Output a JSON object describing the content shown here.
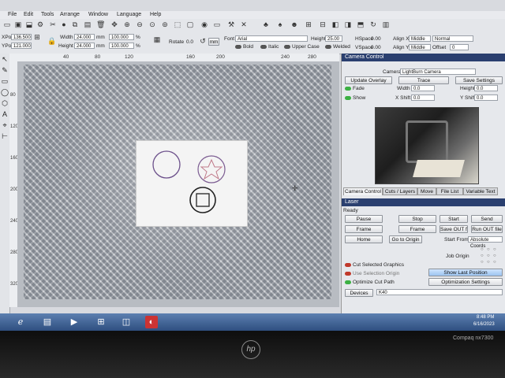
{
  "menu": [
    "File",
    "Edit",
    "Tools",
    "Arrange",
    "Window",
    "Language",
    "Help"
  ],
  "toolbar": {
    "x_label": "XPos",
    "x_value": "136.500",
    "y_label": "YPos",
    "y_value": "121.000",
    "width_label": "Width",
    "width_value": "24.000",
    "height_label": "Height",
    "height_value": "24.000",
    "unit_mm": "mm",
    "scale_w": "100.000",
    "scale_h": "100.000",
    "pct": "%",
    "rotate_label": "Rotate",
    "rotate_value": "0.0",
    "mm_toggle": "mm",
    "font_label": "Font",
    "font_value": "Arial",
    "text_height_label": "Height",
    "text_height_value": "25.00",
    "hspace_label": "HSpace",
    "hspace_value": "0.00",
    "vspace_label": "VSpace",
    "vspace_value": "0.00",
    "alignx_label": "Align X",
    "alignx_value": "Middle",
    "aligny_label": "Align Y",
    "aligny_value": "Middle",
    "mode_value": "Normal",
    "offset_label": "Offset",
    "offset_value": "0",
    "bold": "Bold",
    "italic": "Italic",
    "upper": "Upper Case",
    "welded": "Welded"
  },
  "ruler": {
    "top": [
      "40",
      "80",
      "120",
      "160",
      "200",
      "240",
      "280"
    ],
    "left": [
      "80",
      "120",
      "160",
      "200",
      "240",
      "280",
      "320"
    ]
  },
  "camera_panel": {
    "title": "Camera Control",
    "camera_label": "Camera:",
    "camera_value": "LightBurn Camera",
    "update_overlay": "Update Overlay",
    "trace": "Trace",
    "save_settings": "Save Settings",
    "fade": "Fade",
    "show": "Show",
    "width_label": "Width",
    "width_value": "0.0",
    "height_label": "Height",
    "height_value": "0.0",
    "xshift_label": "X Shift",
    "xshift_value": "0.0",
    "yshift_label": "Y Shift",
    "yshift_value": "0.0"
  },
  "panel_tabs": [
    "Camera Control",
    "Cuts / Layers",
    "Move",
    "File List",
    "Variable Text"
  ],
  "laser_panel": {
    "title": "Laser",
    "status": "Ready",
    "pause": "Pause",
    "stop": "Stop",
    "start": "Start",
    "send": "Send",
    "frame1": "Frame",
    "frame2": "Frame",
    "save_out": "Save OUT file",
    "run_out": "Run OUT file",
    "home": "Home",
    "go_origin": "Go to Origin",
    "start_from_label": "Start From:",
    "start_from_value": "Absolute Coords",
    "job_origin": "Job Origin",
    "cut_selected": "Cut Selected Graphics",
    "use_selection_origin": "Use Selection Origin",
    "optimize": "Optimize Cut Path",
    "show_last": "Show Last Position",
    "opt_settings": "Optimization Settings",
    "devices": "Devices",
    "device_value": "K40"
  },
  "taskbar": {
    "time": "8:48 PM",
    "date": "6/16/2023"
  },
  "laptop": {
    "brand": "hp",
    "model": "Compaq nx7300"
  },
  "colors": {
    "accent": "#2a3f6f",
    "toggle_on": "#3cb043",
    "toggle_off": "#c0392b"
  }
}
